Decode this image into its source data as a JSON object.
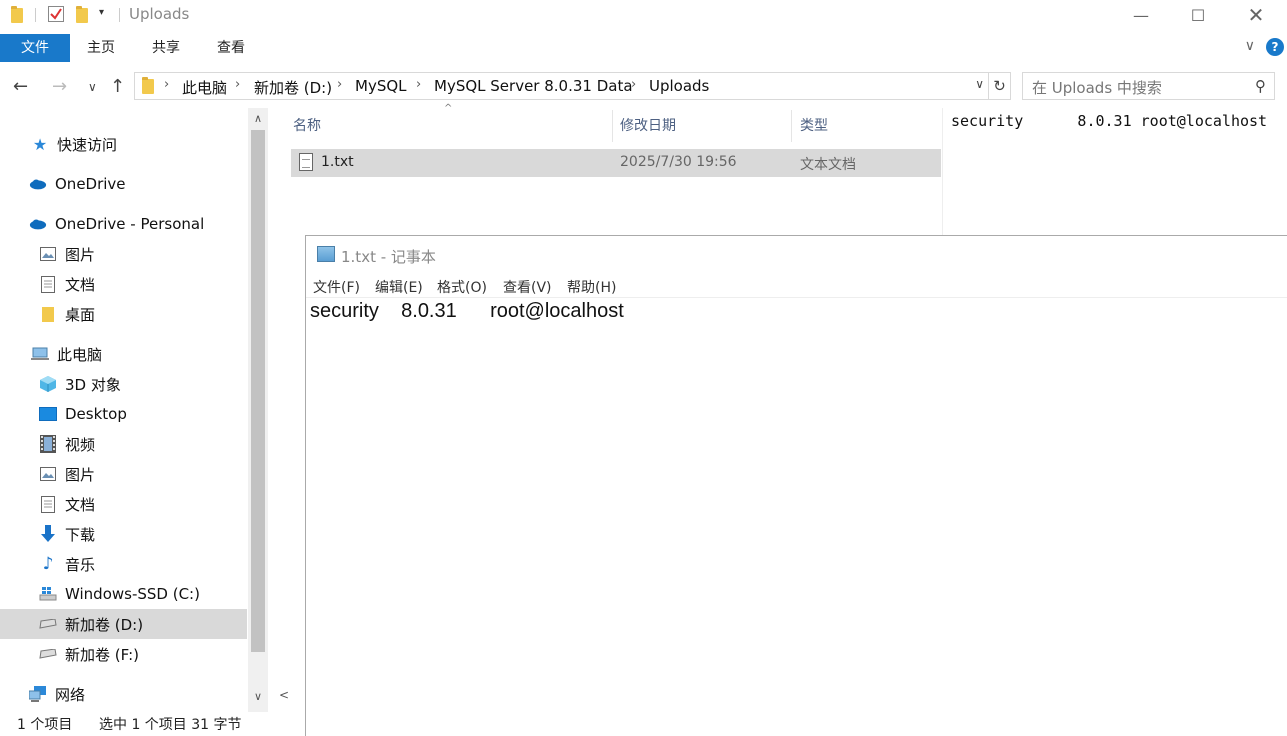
{
  "explorer": {
    "window_title": "Uploads",
    "ribbon_tabs": [
      "文件",
      "主页",
      "共享",
      "查看"
    ],
    "address": {
      "crumbs": [
        "此电脑",
        "新加卷 (D:)",
        "MySQL",
        "MySQL Server 8.0.31 Data",
        "Uploads"
      ]
    },
    "search": {
      "placeholder": "在 Uploads 中搜索"
    },
    "columns": {
      "name": "名称",
      "modified": "修改日期",
      "type": "类型"
    },
    "files": [
      {
        "name": "1.txt",
        "modified": "2025/7/30 19:56",
        "type": "文本文档",
        "selected": true
      }
    ],
    "preview_text": "security      8.0.31 root@localhost",
    "nav": {
      "quick_access": "快速访问",
      "onedrive": "OneDrive",
      "onedrive_personal": "OneDrive - Personal",
      "od_pictures": "图片",
      "od_documents": "文档",
      "od_desktop": "桌面",
      "this_pc": "此电脑",
      "objects3d": "3D 对象",
      "desktop": "Desktop",
      "videos": "视频",
      "pictures": "图片",
      "documents": "文档",
      "downloads": "下载",
      "music": "音乐",
      "drive_c": "Windows-SSD (C:)",
      "drive_d": "新加卷 (D:)",
      "drive_f": "新加卷 (F:)",
      "network": "网络"
    },
    "status": {
      "count": "1 个项目",
      "selected": "选中 1 个项目  31 字节"
    }
  },
  "notepad": {
    "title": "1.txt - 记事本",
    "menu": [
      "文件(F)",
      "编辑(E)",
      "格式(O)",
      "查看(V)",
      "帮助(H)"
    ],
    "content": "security    8.0.31      root@localhost"
  },
  "colors": {
    "accent": "#1979ca",
    "selection": "#d9d9d9",
    "header_text": "#4d6082"
  }
}
